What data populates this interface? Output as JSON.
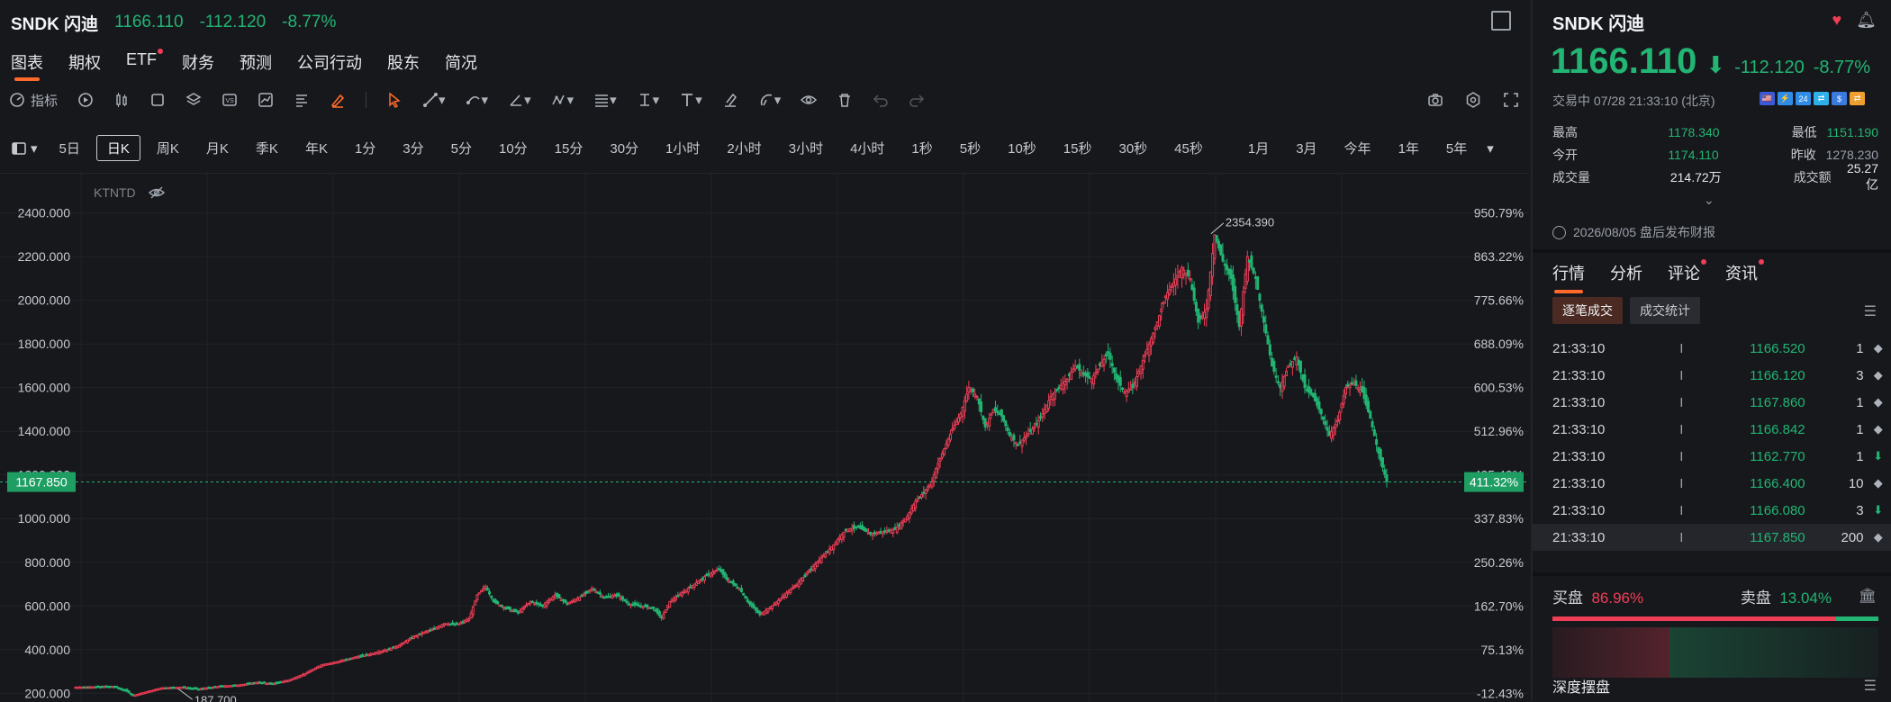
{
  "header": {
    "symbol": "SNDK 闪迪",
    "price": "1166.110",
    "change": "-112.120",
    "change_pct": "-8.77%"
  },
  "nav": [
    {
      "label": "图表",
      "active": true
    },
    {
      "label": "期权"
    },
    {
      "label": "ETF",
      "dot": true
    },
    {
      "label": "财务"
    },
    {
      "label": "预测"
    },
    {
      "label": "公司行动"
    },
    {
      "label": "股东"
    },
    {
      "label": "简况"
    }
  ],
  "toolbar": {
    "indicator_label": "指标"
  },
  "periods": [
    "5日",
    "日K",
    "周K",
    "月K",
    "季K",
    "年K",
    "1分",
    "3分",
    "5分",
    "10分",
    "15分",
    "30分",
    "1小时",
    "2小时",
    "3小时",
    "4小时",
    "1秒",
    "5秒",
    "10秒",
    "15秒",
    "30秒",
    "45秒",
    "1月",
    "3月",
    "今年",
    "1年",
    "5年"
  ],
  "active_period": "日K",
  "chart_data": {
    "type": "candlestick",
    "watermark": "KTNTD",
    "y_ticks": [
      "2400.000",
      "2200.000",
      "2000.000",
      "1800.000",
      "1600.000",
      "1400.000",
      "1200.000",
      "1000.000",
      "800.000",
      "600.000",
      "400.000",
      "200.000"
    ],
    "y_ticks_value": [
      2400,
      2200,
      2000,
      1800,
      1600,
      1400,
      1200,
      1000,
      800,
      600,
      400,
      200
    ],
    "pct_ticks": [
      "950.79%",
      "863.22%",
      "775.66%",
      "688.09%",
      "600.53%",
      "512.96%",
      "425.40%",
      "337.83%",
      "250.26%",
      "162.70%",
      "75.13%",
      "-12.43%"
    ],
    "ylim": [
      160,
      2580
    ],
    "current_price_label": "1167.850",
    "current_price_value": 1167.85,
    "current_pct_label": "411.32%",
    "high_label": "2354.390",
    "high_value": 2354.39,
    "low_label": "187.700",
    "low_value": 187.7,
    "close_path": [
      [
        0,
        228
      ],
      [
        10,
        230
      ],
      [
        18,
        232
      ],
      [
        24,
        215
      ],
      [
        28,
        190
      ],
      [
        34,
        205
      ],
      [
        42,
        225
      ],
      [
        52,
        228
      ],
      [
        60,
        220
      ],
      [
        70,
        232
      ],
      [
        80,
        238
      ],
      [
        88,
        250
      ],
      [
        96,
        245
      ],
      [
        104,
        260
      ],
      [
        112,
        290
      ],
      [
        120,
        330
      ],
      [
        128,
        345
      ],
      [
        136,
        365
      ],
      [
        144,
        380
      ],
      [
        152,
        400
      ],
      [
        158,
        420
      ],
      [
        164,
        455
      ],
      [
        170,
        480
      ],
      [
        176,
        500
      ],
      [
        180,
        520
      ],
      [
        186,
        515
      ],
      [
        192,
        540
      ],
      [
        196,
        650
      ],
      [
        200,
        690
      ],
      [
        204,
        620
      ],
      [
        210,
        590
      ],
      [
        216,
        570
      ],
      [
        222,
        620
      ],
      [
        228,
        600
      ],
      [
        234,
        650
      ],
      [
        240,
        610
      ],
      [
        246,
        640
      ],
      [
        252,
        680
      ],
      [
        258,
        640
      ],
      [
        264,
        650
      ],
      [
        270,
        610
      ],
      [
        276,
        600
      ],
      [
        282,
        590
      ],
      [
        286,
        545
      ],
      [
        290,
        620
      ],
      [
        296,
        660
      ],
      [
        302,
        700
      ],
      [
        308,
        740
      ],
      [
        314,
        770
      ],
      [
        318,
        720
      ],
      [
        324,
        680
      ],
      [
        328,
        620
      ],
      [
        334,
        560
      ],
      [
        340,
        600
      ],
      [
        346,
        650
      ],
      [
        352,
        700
      ],
      [
        358,
        760
      ],
      [
        364,
        820
      ],
      [
        370,
        880
      ],
      [
        376,
        950
      ],
      [
        382,
        960
      ],
      [
        388,
        930
      ],
      [
        394,
        940
      ],
      [
        400,
        950
      ],
      [
        406,
        1010
      ],
      [
        410,
        1080
      ],
      [
        414,
        1120
      ],
      [
        418,
        1170
      ],
      [
        420,
        1230
      ],
      [
        424,
        1320
      ],
      [
        428,
        1410
      ],
      [
        432,
        1480
      ],
      [
        436,
        1600
      ],
      [
        440,
        1560
      ],
      [
        444,
        1420
      ],
      [
        448,
        1500
      ],
      [
        452,
        1470
      ],
      [
        456,
        1380
      ],
      [
        460,
        1340
      ],
      [
        464,
        1380
      ],
      [
        468,
        1420
      ],
      [
        472,
        1480
      ],
      [
        476,
        1560
      ],
      [
        480,
        1600
      ],
      [
        484,
        1640
      ],
      [
        488,
        1700
      ],
      [
        492,
        1660
      ],
      [
        496,
        1640
      ],
      [
        500,
        1700
      ],
      [
        504,
        1760
      ],
      [
        508,
        1640
      ],
      [
        512,
        1580
      ],
      [
        516,
        1600
      ],
      [
        520,
        1700
      ],
      [
        524,
        1800
      ],
      [
        528,
        1900
      ],
      [
        532,
        2020
      ],
      [
        536,
        2080
      ],
      [
        540,
        2150
      ],
      [
        544,
        2100
      ],
      [
        548,
        1900
      ],
      [
        552,
        1960
      ],
      [
        556,
        2300
      ],
      [
        560,
        2180
      ],
      [
        564,
        2100
      ],
      [
        568,
        1880
      ],
      [
        572,
        2200
      ],
      [
        576,
        2100
      ],
      [
        580,
        1900
      ],
      [
        584,
        1700
      ],
      [
        588,
        1600
      ],
      [
        592,
        1700
      ],
      [
        596,
        1740
      ],
      [
        600,
        1600
      ],
      [
        604,
        1560
      ],
      [
        608,
        1480
      ],
      [
        612,
        1380
      ],
      [
        616,
        1450
      ],
      [
        620,
        1600
      ],
      [
        624,
        1620
      ],
      [
        628,
        1580
      ],
      [
        632,
        1460
      ],
      [
        636,
        1300
      ],
      [
        640,
        1170
      ]
    ]
  },
  "right": {
    "title": "SNDK 闪迪",
    "price": "1166.110",
    "change": "-112.120",
    "change_pct": "-8.77%",
    "status": "交易中 07/28 21:33:10 (北京)",
    "flags": [
      "🇺🇸",
      "⚡",
      "24",
      "⇄",
      "$",
      "⇄"
    ],
    "stats": {
      "high_label": "最高",
      "high": "1178.340",
      "low_label": "最低",
      "low": "1151.190",
      "open_label": "今开",
      "open": "1174.110",
      "prev_label": "昨收",
      "prev": "1278.230",
      "vol_label": "成交量",
      "vol": "214.72万",
      "amt_label": "成交额",
      "amt": "25.27亿"
    },
    "earnings": "2026/08/05 盘后发布财报",
    "tabs": [
      {
        "label": "行情",
        "active": true
      },
      {
        "label": "分析"
      },
      {
        "label": "评论",
        "dot": true
      },
      {
        "label": "资讯",
        "dot": true
      }
    ],
    "subtabs": [
      {
        "label": "逐笔成交",
        "active": true
      },
      {
        "label": "成交统计"
      }
    ],
    "trades": [
      {
        "time": "21:33:10",
        "price": "1166.520",
        "vol": "1",
        "dir": "◆"
      },
      {
        "time": "21:33:10",
        "price": "1166.120",
        "vol": "3",
        "dir": "◆"
      },
      {
        "time": "21:33:10",
        "price": "1167.860",
        "vol": "1",
        "dir": "◆"
      },
      {
        "time": "21:33:10",
        "price": "1166.842",
        "vol": "1",
        "dir": "◆"
      },
      {
        "time": "21:33:10",
        "price": "1162.770",
        "vol": "1",
        "dir": "⬇",
        "down": true
      },
      {
        "time": "21:33:10",
        "price": "1166.400",
        "vol": "10",
        "dir": "◆"
      },
      {
        "time": "21:33:10",
        "price": "1166.080",
        "vol": "3",
        "dir": "⬇",
        "down": true
      },
      {
        "time": "21:33:10",
        "price": "1167.850",
        "vol": "200",
        "dir": "◆"
      }
    ],
    "buy_label": "买盘",
    "buy_pct": "86.96%",
    "buy_value": 86.96,
    "sell_label": "卖盘",
    "sell_pct": "13.04%",
    "depth_title": "深度摆盘"
  }
}
